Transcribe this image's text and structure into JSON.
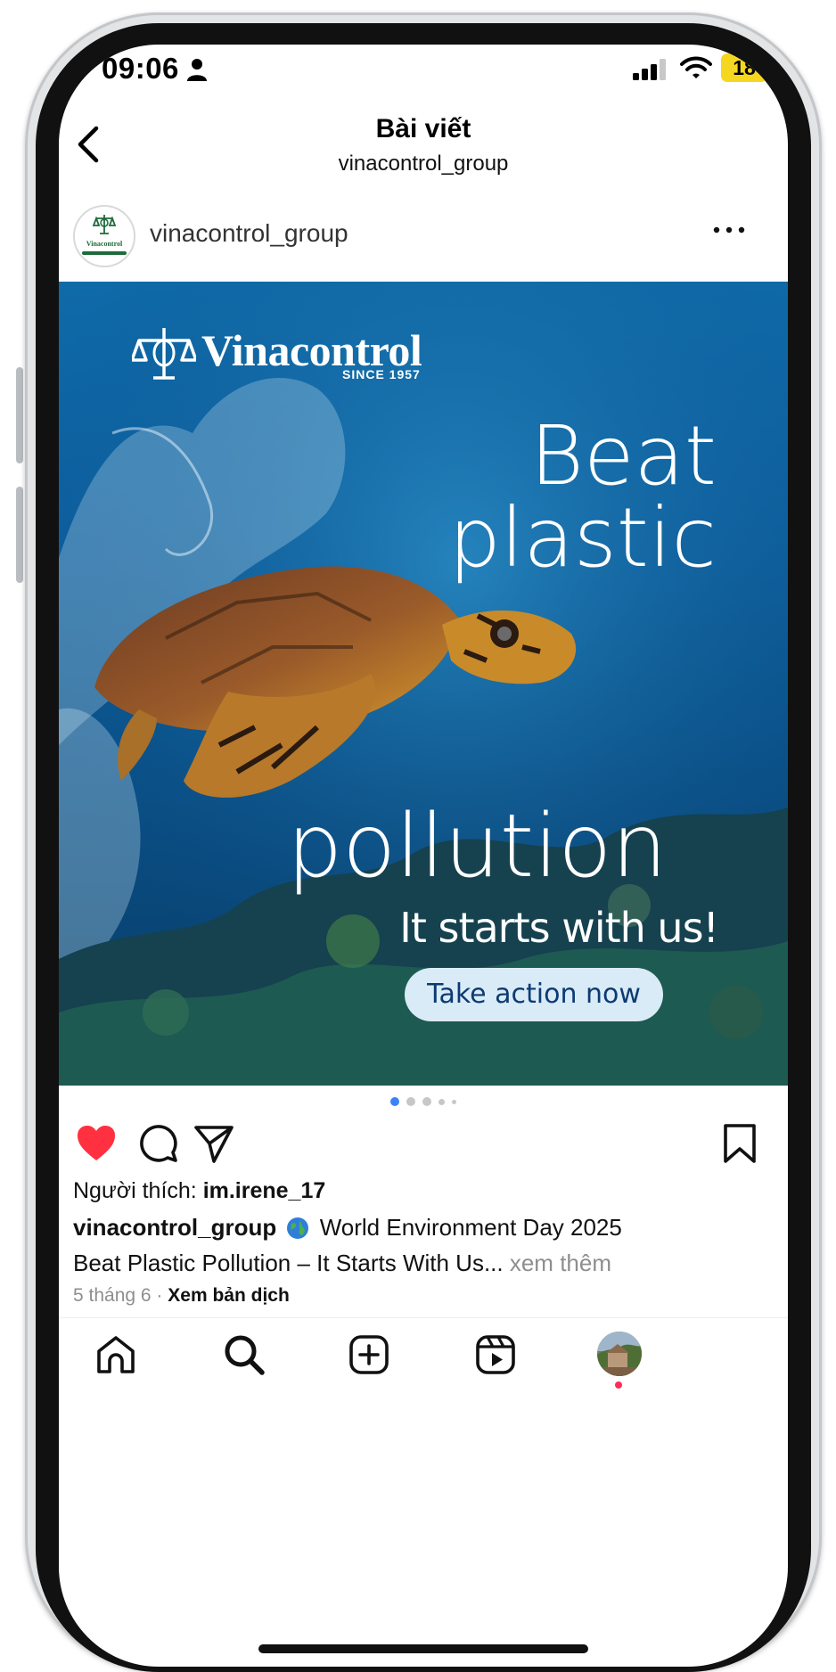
{
  "status_bar": {
    "time": "09:06",
    "battery": "18"
  },
  "header": {
    "title": "Bài viết",
    "subtitle": "vinacontrol_group"
  },
  "post": {
    "username": "vinacontrol_group",
    "avatar_text": "Vinacontrol",
    "image": {
      "brand_name": "Vinacontrol",
      "brand_since": "SINCE 1957",
      "headline_1": "Beat",
      "headline_2": "plastic",
      "headline_3": "pollution",
      "tagline": "It starts with us!",
      "cta": "Take action now"
    },
    "carousel": {
      "count": 5,
      "active": 0
    },
    "liked": true,
    "likes_prefix": "Người thích: ",
    "likes_user": "im.irene_17",
    "caption_user": "vinacontrol_group",
    "caption_line1": " World Environment Day 2025",
    "caption_line2": "Beat Plastic Pollution – It Starts With Us...",
    "more_label": " xem thêm",
    "date": "5 tháng 6",
    "separator": " · ",
    "translate_label": "Xem bản dịch"
  },
  "icons": {
    "back": "chevron-left-icon",
    "more": "more-horizontal-icon",
    "like": "heart-icon",
    "comment": "comment-icon",
    "share": "send-icon",
    "save": "bookmark-icon",
    "home": "home-icon",
    "search": "search-icon",
    "create": "plus-square-icon",
    "reels": "reels-icon"
  },
  "colors": {
    "like": "#ff3040",
    "carousel_active": "#3b82f6",
    "cta_bg": "#d9ebf6",
    "cta_text": "#0d3a73",
    "battery": "#f6d71f"
  }
}
